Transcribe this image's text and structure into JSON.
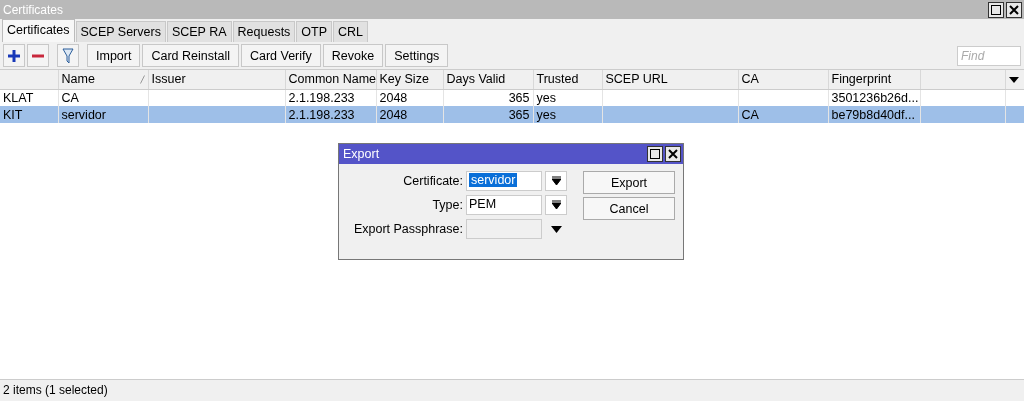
{
  "window": {
    "title": "Certificates"
  },
  "tabs": [
    {
      "label": "Certificates",
      "selected": true
    },
    {
      "label": "SCEP Servers",
      "selected": false
    },
    {
      "label": "SCEP RA",
      "selected": false
    },
    {
      "label": "Requests",
      "selected": false
    },
    {
      "label": "OTP",
      "selected": false
    },
    {
      "label": "CRL",
      "selected": false
    }
  ],
  "toolbar": {
    "buttons": [
      "Import",
      "Card Reinstall",
      "Card Verify",
      "Revoke",
      "Settings"
    ],
    "search": {
      "placeholder": "Find"
    }
  },
  "table": {
    "columns": [
      {},
      {
        "label": "Name",
        "sorted": true
      },
      {
        "label": "Issuer"
      },
      {
        "label": "Common Name"
      },
      {
        "label": "Key Size"
      },
      {
        "label": "Days Valid"
      },
      {
        "label": "Trusted"
      },
      {
        "label": "SCEP URL"
      },
      {
        "label": "CA"
      },
      {
        "label": "Fingerprint"
      }
    ],
    "rows": [
      {
        "selected": false,
        "cells": [
          "KLAT",
          "CA",
          "",
          "2.1.198.233",
          "2048",
          "365",
          "yes",
          "",
          "",
          "3501236b26d..."
        ]
      },
      {
        "selected": true,
        "cells": [
          "KIT",
          "servidor",
          "",
          "2.1.198.233",
          "2048",
          "365",
          "yes",
          "",
          "CA",
          "be79b8d40df..."
        ]
      }
    ]
  },
  "dialog": {
    "title": "Export",
    "fields": [
      {
        "label": "Certificate:",
        "value": "servidor",
        "highlighted": true,
        "disabled": false
      },
      {
        "label": "Type:",
        "value": "PEM",
        "highlighted": false,
        "disabled": false
      },
      {
        "label": "Export Passphrase:",
        "highlighted": false,
        "disabled": true
      }
    ],
    "buttons": [
      "Export",
      "Cancel"
    ]
  },
  "status_bar": "2 items (1 selected)"
}
